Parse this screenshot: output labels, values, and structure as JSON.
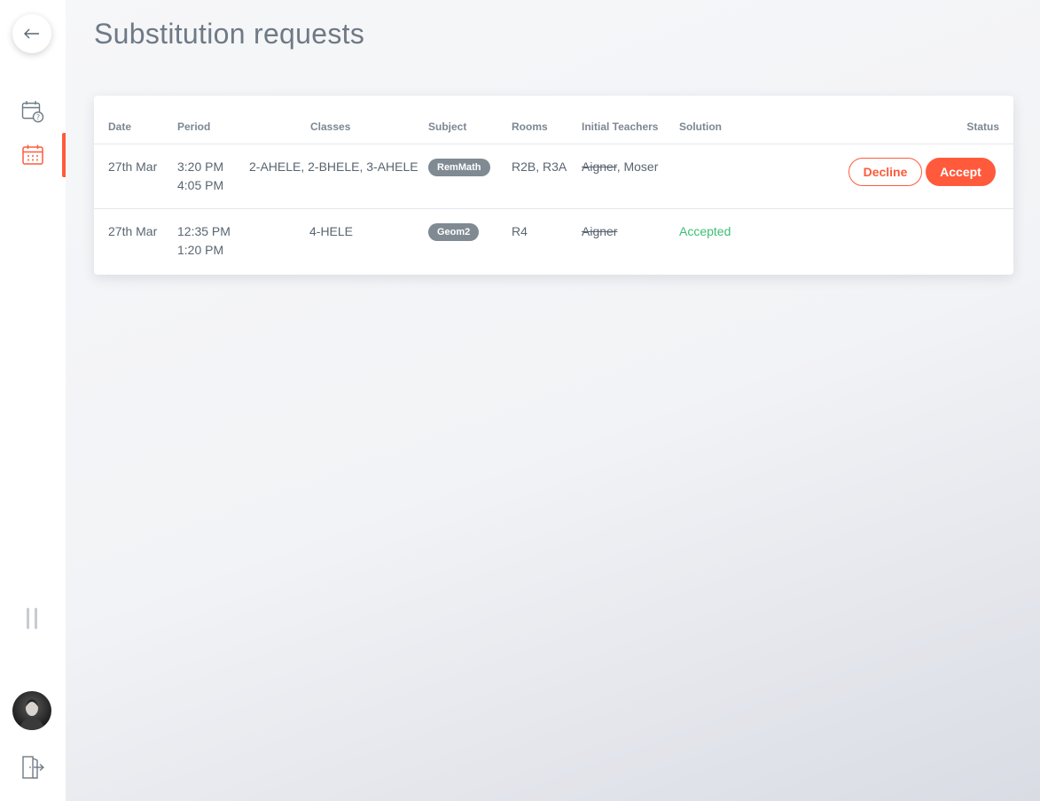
{
  "page": {
    "title": "Substitution requests"
  },
  "colors": {
    "accent": "#ff5a3c",
    "accepted": "#3cbf72",
    "pill": "#7f8a93"
  },
  "sidebar": {
    "back_icon": "arrow-left-icon",
    "nav": [
      {
        "icon": "calendar-question-icon",
        "active": false
      },
      {
        "icon": "calendar-icon",
        "active": true
      }
    ],
    "drag_icon": "drag-handle-icon",
    "avatar_icon": "user-avatar",
    "logout_icon": "logout-icon"
  },
  "table": {
    "headers": {
      "date": "Date",
      "period": "Period",
      "classes": "Classes",
      "subject": "Subject",
      "rooms": "Rooms",
      "initial_teachers": "Initial Teachers",
      "solution": "Solution",
      "status": "Status"
    },
    "rows": [
      {
        "date": "27th Mar",
        "period_start": "3:20 PM",
        "period_end": "4:05 PM",
        "classes": "2-AHELE, 2-BHELE, 3-AHELE",
        "subject": "RemMath",
        "rooms": "R2B, R3A",
        "teacher_struck": "Aigner",
        "teacher_sep": ", ",
        "teacher_other": "Moser",
        "solution": "",
        "decline_label": "Decline",
        "accept_label": "Accept"
      },
      {
        "date": "27th Mar",
        "period_start": "12:35 PM",
        "period_end": "1:20 PM",
        "classes": "4-HELE",
        "subject": "Geom2",
        "rooms": "R4",
        "teacher_struck": "Aigner",
        "solution": "Accepted"
      }
    ]
  }
}
